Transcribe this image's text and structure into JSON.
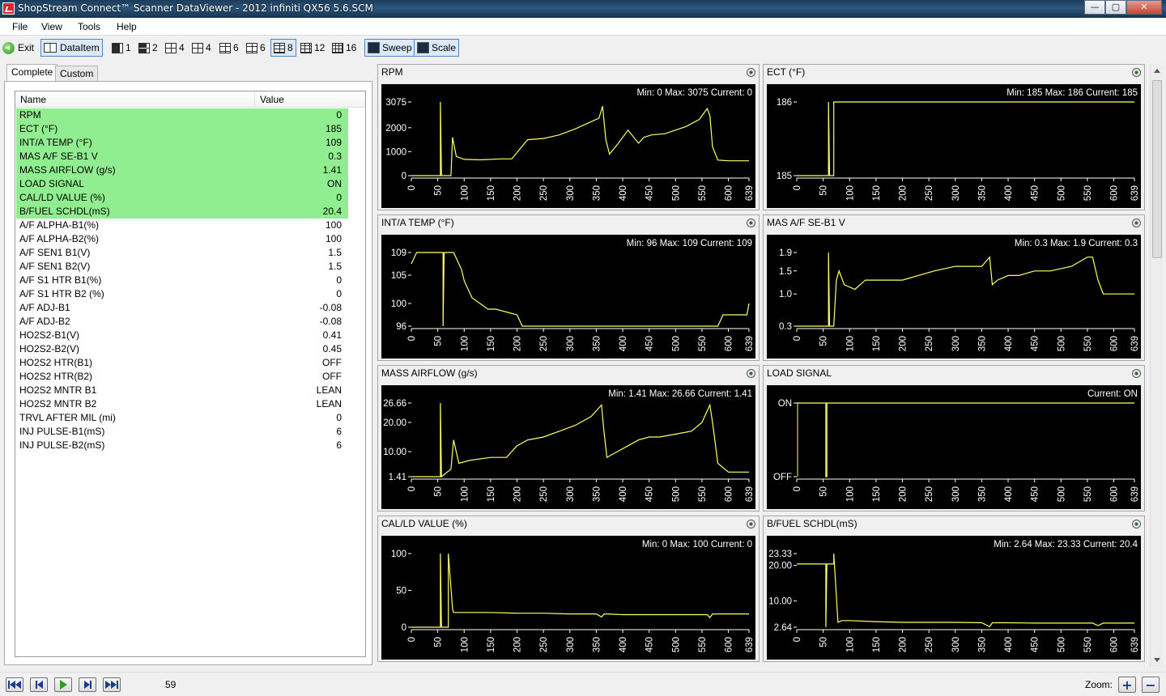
{
  "window": {
    "title": "ShopStream Connect™ Scanner DataViewer - 2012 infiniti QX56 5.6.SCM",
    "minimize": "—",
    "maximize": "▢",
    "close": "✕"
  },
  "menu": [
    "File",
    "View",
    "Tools",
    "Help"
  ],
  "toolbar": {
    "exit": "Exit",
    "dataitem": "DataItem",
    "layouts": [
      "1",
      "2",
      "4",
      "4",
      "6",
      "6",
      "8",
      "12",
      "16"
    ],
    "sweep": "Sweep",
    "scale": "Scale"
  },
  "tabs": {
    "complete": "Complete",
    "custom": "Custom"
  },
  "list": {
    "header_name": "Name",
    "header_value": "Value",
    "rows": [
      {
        "name": "RPM",
        "value": "0",
        "selected": true
      },
      {
        "name": "ECT (°F)",
        "value": "185",
        "selected": true
      },
      {
        "name": "INT/A TEMP (°F)",
        "value": "109",
        "selected": true
      },
      {
        "name": "MAS A/F SE-B1 V",
        "value": "0.3",
        "selected": true
      },
      {
        "name": "MASS AIRFLOW (g/s)",
        "value": "1.41",
        "selected": true
      },
      {
        "name": "LOAD SIGNAL",
        "value": "ON",
        "selected": true
      },
      {
        "name": "CAL/LD VALUE (%)",
        "value": "0",
        "selected": true
      },
      {
        "name": "B/FUEL SCHDL(mS)",
        "value": "20.4",
        "selected": true
      },
      {
        "name": "A/F ALPHA-B1(%)",
        "value": "100",
        "selected": false
      },
      {
        "name": "A/F ALPHA-B2(%)",
        "value": "100",
        "selected": false
      },
      {
        "name": "A/F SEN1 B1(V)",
        "value": "1.5",
        "selected": false
      },
      {
        "name": "A/F SEN1 B2(V)",
        "value": "1.5",
        "selected": false
      },
      {
        "name": "A/F S1 HTR B1(%)",
        "value": "0",
        "selected": false
      },
      {
        "name": "A/F S1 HTR B2 (%)",
        "value": "0",
        "selected": false
      },
      {
        "name": "A/F ADJ-B1",
        "value": "-0.08",
        "selected": false
      },
      {
        "name": "A/F ADJ-B2",
        "value": "-0.08",
        "selected": false
      },
      {
        "name": "HO2S2-B1(V)",
        "value": "0.41",
        "selected": false
      },
      {
        "name": "HO2S2-B2(V)",
        "value": "0.45",
        "selected": false
      },
      {
        "name": "HO2S2 HTR(B1)",
        "value": "OFF",
        "selected": false
      },
      {
        "name": "HO2S2 HTR(B2)",
        "value": "OFF",
        "selected": false
      },
      {
        "name": "HO2S2 MNTR B1",
        "value": "LEAN",
        "selected": false
      },
      {
        "name": "HO2S2 MNTR B2",
        "value": "LEAN",
        "selected": false
      },
      {
        "name": "TRVL AFTER MIL (mi)",
        "value": "0",
        "selected": false
      },
      {
        "name": "INJ PULSE-B1(mS)",
        "value": "6",
        "selected": false
      },
      {
        "name": "INJ PULSE-B2(mS)",
        "value": "6",
        "selected": false
      }
    ]
  },
  "bottom": {
    "frame": "59",
    "zoom_label": "Zoom:",
    "zoom_in": "+",
    "zoom_out": "−"
  },
  "colors": {
    "trace": "#ffff66",
    "plot_bg": "#000000",
    "selected_row": "#90ee90"
  },
  "chart_data": [
    {
      "type": "line",
      "title": "RPM",
      "stats": "Min: 0    Max: 3075    Current: 0",
      "yticks": [
        "3075",
        "2000",
        "1000",
        "0"
      ],
      "yvals": [
        3075,
        2000,
        1000,
        0
      ],
      "ylim": [
        0,
        3075
      ],
      "xticks": [
        "0",
        "50",
        "100",
        "150",
        "200",
        "250",
        "300",
        "350",
        "400",
        "450",
        "500",
        "550",
        "600",
        "639"
      ],
      "x": [
        0,
        55,
        55,
        57,
        57,
        75,
        78,
        85,
        100,
        130,
        170,
        190,
        220,
        250,
        280,
        310,
        340,
        355,
        362,
        368,
        375,
        390,
        410,
        430,
        440,
        455,
        480,
        520,
        545,
        560,
        565,
        570,
        580,
        600,
        639
      ],
      "y": [
        0,
        0,
        3075,
        0,
        0,
        0,
        1600,
        800,
        680,
        660,
        700,
        700,
        1500,
        1550,
        1700,
        1950,
        2250,
        2400,
        2900,
        1500,
        900,
        1300,
        1900,
        1350,
        1600,
        1700,
        1750,
        2050,
        2350,
        2800,
        2500,
        1200,
        650,
        620,
        620
      ]
    },
    {
      "type": "line",
      "title": "ECT (°F)",
      "stats": "Min: 185    Max: 186    Current: 185",
      "yticks": [
        "186",
        "185"
      ],
      "yvals": [
        186,
        185
      ],
      "ylim": [
        185,
        186
      ],
      "xticks": [
        "0",
        "50",
        "100",
        "150",
        "200",
        "250",
        "300",
        "350",
        "400",
        "450",
        "500",
        "550",
        "600",
        "639"
      ],
      "x": [
        0,
        60,
        60,
        62,
        62,
        70,
        70,
        639
      ],
      "y": [
        185,
        185,
        186,
        185,
        185,
        185,
        186,
        186
      ]
    },
    {
      "type": "line",
      "title": "INT/A TEMP (°F)",
      "stats": "Min: 96    Max: 109    Current: 109",
      "yticks": [
        "109",
        "105",
        "100",
        "96"
      ],
      "yvals": [
        109,
        105,
        100,
        96
      ],
      "ylim": [
        96,
        109
      ],
      "xticks": [
        "0",
        "50",
        "100",
        "150",
        "200",
        "250",
        "300",
        "350",
        "400",
        "450",
        "500",
        "550",
        "600",
        "639"
      ],
      "x": [
        0,
        10,
        60,
        60,
        62,
        80,
        90,
        95,
        100,
        105,
        110,
        115,
        130,
        145,
        160,
        200,
        210,
        580,
        590,
        635,
        639
      ],
      "y": [
        107,
        109,
        109,
        96,
        109,
        109,
        107,
        106,
        104,
        103,
        102,
        101,
        100,
        99,
        99,
        98,
        96,
        96,
        98,
        98,
        100
      ]
    },
    {
      "type": "line",
      "title": "MAS A/F SE-B1 V",
      "stats": "Min: 0.3    Max: 1.9    Current: 0.3",
      "yticks": [
        "1.9",
        "1.5",
        "1.0",
        "0.3"
      ],
      "yvals": [
        1.9,
        1.5,
        1.0,
        0.3
      ],
      "ylim": [
        0.3,
        1.9
      ],
      "xticks": [
        "0",
        "50",
        "100",
        "150",
        "200",
        "250",
        "300",
        "350",
        "400",
        "450",
        "500",
        "550",
        "600",
        "639"
      ],
      "x": [
        0,
        60,
        60,
        62,
        70,
        75,
        80,
        90,
        110,
        130,
        200,
        230,
        260,
        300,
        350,
        365,
        370,
        380,
        400,
        420,
        450,
        480,
        520,
        550,
        560,
        570,
        580,
        600,
        639
      ],
      "y": [
        0.3,
        0.3,
        1.9,
        0.3,
        0.3,
        1.3,
        1.5,
        1.2,
        1.1,
        1.3,
        1.3,
        1.4,
        1.5,
        1.6,
        1.6,
        1.8,
        1.2,
        1.3,
        1.4,
        1.4,
        1.5,
        1.5,
        1.6,
        1.8,
        1.8,
        1.3,
        1.0,
        1.0,
        1.0
      ]
    },
    {
      "type": "line",
      "title": "MASS AIRFLOW (g/s)",
      "stats": "Min: 1.41    Max: 26.66    Current: 1.41",
      "yticks": [
        "26.66",
        "20.00",
        "10.00",
        "1.41"
      ],
      "yvals": [
        26.66,
        20,
        10,
        1.41
      ],
      "ylim": [
        1.41,
        26.66
      ],
      "xticks": [
        "0",
        "50",
        "100",
        "150",
        "200",
        "250",
        "300",
        "350",
        "400",
        "450",
        "500",
        "550",
        "600",
        "639"
      ],
      "x": [
        0,
        55,
        55,
        57,
        57,
        75,
        80,
        90,
        110,
        150,
        180,
        200,
        220,
        250,
        280,
        310,
        340,
        360,
        364,
        370,
        390,
        410,
        430,
        450,
        470,
        500,
        530,
        550,
        560,
        565,
        570,
        580,
        600,
        639
      ],
      "y": [
        1.41,
        1.41,
        26.66,
        1.41,
        1.41,
        4,
        14,
        6,
        7,
        8,
        8,
        12,
        14,
        15,
        17,
        19,
        22,
        26,
        18,
        8,
        10,
        12,
        14,
        15,
        15,
        16,
        17,
        20,
        24,
        26,
        20,
        6,
        3,
        3
      ]
    },
    {
      "type": "line",
      "title": "LOAD SIGNAL",
      "stats": "Current: ON",
      "yticks": [
        "ON",
        "OFF"
      ],
      "yvals": [
        1,
        0
      ],
      "ylim": [
        0,
        1
      ],
      "xticks": [
        "0",
        "50",
        "100",
        "150",
        "200",
        "250",
        "300",
        "350",
        "400",
        "450",
        "500",
        "550",
        "600",
        "639"
      ],
      "x": [
        0,
        55,
        55,
        57,
        57,
        639
      ],
      "y": [
        1,
        1,
        0,
        0,
        1,
        1
      ],
      "extra_x": [
        0
      ]
    },
    {
      "type": "line",
      "title": "CAL/LD VALUE (%)",
      "stats": "Min: 0    Max: 100    Current: 0",
      "yticks": [
        "100",
        "50",
        "0"
      ],
      "yvals": [
        100,
        50,
        0
      ],
      "ylim": [
        0,
        100
      ],
      "xticks": [
        "0",
        "50",
        "100",
        "150",
        "200",
        "250",
        "300",
        "350",
        "400",
        "450",
        "500",
        "550",
        "600",
        "639"
      ],
      "x": [
        0,
        55,
        55,
        57,
        57,
        70,
        70,
        78,
        80,
        100,
        150,
        200,
        250,
        300,
        350,
        360,
        365,
        370,
        400,
        450,
        500,
        560,
        565,
        570,
        600,
        639
      ],
      "y": [
        0,
        0,
        100,
        0,
        0,
        0,
        100,
        25,
        20,
        20,
        20,
        19,
        19,
        18,
        18,
        14,
        18,
        18,
        17,
        17,
        17,
        17,
        13,
        18,
        18,
        18
      ]
    },
    {
      "type": "line",
      "title": "B/FUEL SCHDL(mS)",
      "stats": "Min: 2.64    Max: 23.33    Current: 20.4",
      "yticks": [
        "23.33",
        "20.00",
        "10.00",
        "2.64"
      ],
      "yvals": [
        23.33,
        20,
        10,
        2.64
      ],
      "ylim": [
        2.64,
        23.33
      ],
      "xticks": [
        "0",
        "50",
        "100",
        "150",
        "200",
        "250",
        "300",
        "350",
        "400",
        "450",
        "500",
        "550",
        "600",
        "639"
      ],
      "x": [
        0,
        55,
        55,
        57,
        57,
        70,
        70,
        78,
        85,
        100,
        150,
        200,
        250,
        300,
        350,
        365,
        370,
        400,
        450,
        500,
        560,
        570,
        580,
        600,
        639
      ],
      "y": [
        20.4,
        20.4,
        2.64,
        20.4,
        20.4,
        20.4,
        23.33,
        4,
        4.5,
        4.5,
        4.2,
        4,
        4,
        4,
        3.9,
        2.8,
        3.9,
        3.9,
        3.8,
        3.8,
        3.8,
        3.1,
        3.8,
        3.8,
        3.8
      ]
    }
  ]
}
